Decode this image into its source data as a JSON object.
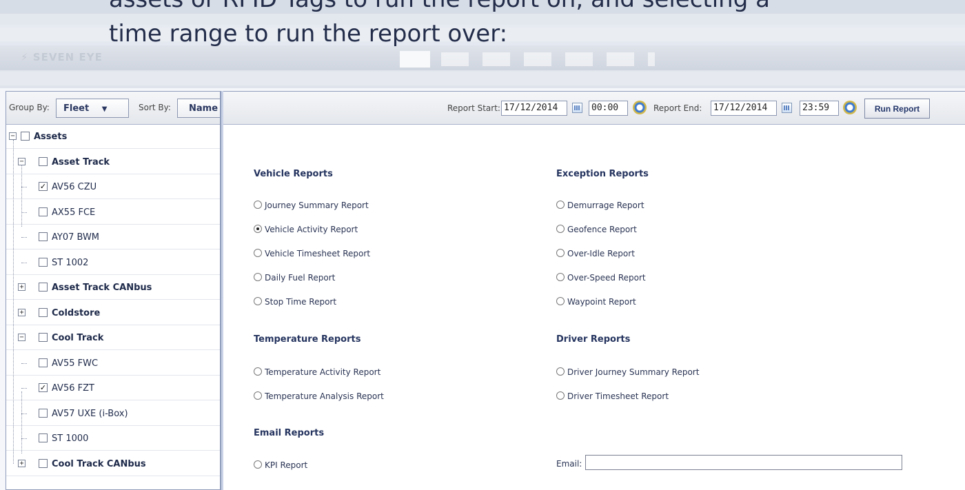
{
  "caption": {
    "line1": "assets or RFID Tags to run the report on, and selecting a",
    "line2": "time range to run the report over:"
  },
  "app": {
    "brand": "SEVEN EYE"
  },
  "left": {
    "group_by_label": "Group By:",
    "group_by_value": "Fleet",
    "sort_by_label": "Sort By:",
    "sort_by_value": "Name",
    "tree": [
      {
        "label": "Assets",
        "bold": true,
        "checked": false,
        "toggle": "−",
        "level": 0
      },
      {
        "label": "Asset Track",
        "bold": true,
        "checked": false,
        "toggle": "−",
        "level": 1
      },
      {
        "label": "AV56 CZU",
        "bold": false,
        "checked": true,
        "level": 2
      },
      {
        "label": "AX55 FCE",
        "bold": false,
        "checked": false,
        "level": 2
      },
      {
        "label": "AY07 BWM",
        "bold": false,
        "checked": false,
        "level": 2
      },
      {
        "label": "ST 1002",
        "bold": false,
        "checked": false,
        "level": 2
      },
      {
        "label": "Asset Track CANbus",
        "bold": true,
        "checked": false,
        "toggle": "+",
        "level": 1
      },
      {
        "label": "Coldstore",
        "bold": true,
        "checked": false,
        "toggle": "+",
        "level": 1
      },
      {
        "label": "Cool Track",
        "bold": true,
        "checked": false,
        "toggle": "−",
        "level": 1
      },
      {
        "label": "AV55 FWC",
        "bold": false,
        "checked": false,
        "level": 2
      },
      {
        "label": "AV56 FZT",
        "bold": false,
        "checked": true,
        "level": 2
      },
      {
        "label": "AV57 UXE (i-Box)",
        "bold": false,
        "checked": false,
        "level": 2
      },
      {
        "label": "ST 1000",
        "bold": false,
        "checked": false,
        "level": 2
      },
      {
        "label": "Cool Track CANbus",
        "bold": true,
        "checked": false,
        "toggle": "+",
        "level": 1
      }
    ]
  },
  "toolbar": {
    "report_start_label": "Report Start:",
    "start_date": "17/12/2014",
    "start_time": "00:00",
    "report_end_label": "Report End:",
    "end_date": "17/12/2014",
    "end_time": "23:59",
    "run_report": "Run Report"
  },
  "reports": {
    "vehicle": {
      "heading": "Vehicle Reports",
      "items": [
        "Journey Summary Report",
        "Vehicle Activity Report",
        "Vehicle Timesheet Report",
        "Daily Fuel Report",
        "Stop Time Report"
      ],
      "selected": "Vehicle Activity Report"
    },
    "exception": {
      "heading": "Exception Reports",
      "items": [
        "Demurrage Report",
        "Geofence Report",
        "Over-Idle Report",
        "Over-Speed Report",
        "Waypoint Report"
      ]
    },
    "temperature": {
      "heading": "Temperature Reports",
      "items": [
        "Temperature Activity Report",
        "Temperature Analysis Report"
      ]
    },
    "driver": {
      "heading": "Driver Reports",
      "items": [
        "Driver Journey Summary Report",
        "Driver Timesheet Report"
      ]
    },
    "email": {
      "heading": "Email Reports",
      "items": [
        "KPI Report"
      ]
    },
    "email_label": "Email:",
    "email_value": ""
  }
}
